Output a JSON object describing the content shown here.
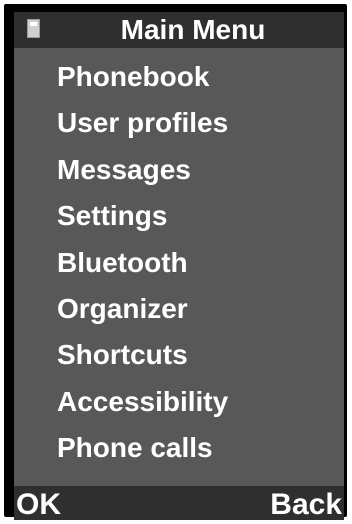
{
  "header": {
    "title": "Main Menu",
    "status_icon": "sim-card-icon"
  },
  "menu": {
    "items": [
      {
        "label": "Phonebook"
      },
      {
        "label": "User profiles"
      },
      {
        "label": "Messages"
      },
      {
        "label": "Settings"
      },
      {
        "label": "Bluetooth"
      },
      {
        "label": "Organizer"
      },
      {
        "label": "Shortcuts"
      },
      {
        "label": "Accessibility"
      },
      {
        "label": "Phone calls"
      }
    ]
  },
  "softkeys": {
    "left_label": "OK",
    "right_label": "Back"
  },
  "colors": {
    "screen_background": "#000000",
    "bar_background": "#2f2f2f",
    "panel_background": "#585858",
    "text": "#ffffff"
  }
}
